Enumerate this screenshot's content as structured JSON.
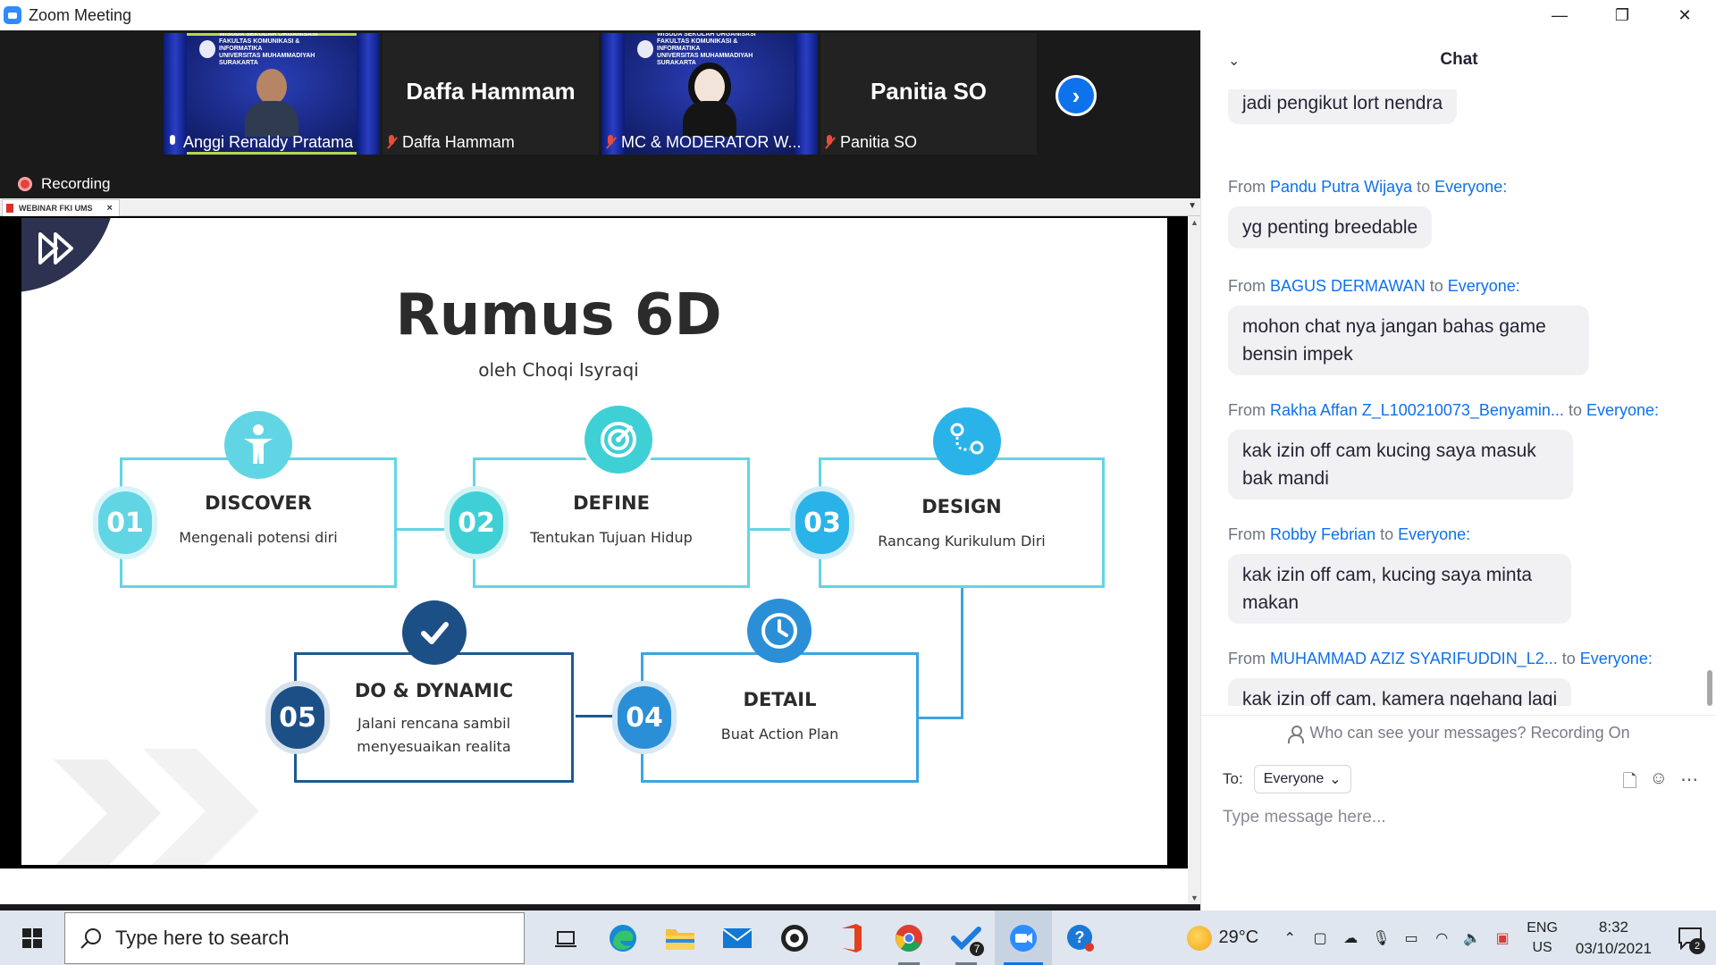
{
  "window": {
    "title": "Zoom Meeting",
    "controls": {
      "minimize": "—",
      "restore": "❐",
      "close": "✕"
    }
  },
  "participants": [
    {
      "video_banner": "WISUDA SEKOLAH ORGANISASI\nFAKULTAS KOMUNIKASI & INFORMATIKA\nUNIVERSITAS MUHAMMADIYAH SURAKARTA",
      "label": "Anggi Renaldy Pratama",
      "mic": "active",
      "active_speaker": true
    },
    {
      "display_name": "Daffa Hammam",
      "label": "Daffa Hammam",
      "mic": "muted"
    },
    {
      "video_banner": "WISUDA SEKOLAH ORGANISASI\nFAKULTAS KOMUNIKASI & INFORMATIKA\nUNIVERSITAS MUHAMMADIYAH SURAKARTA",
      "label": "MC & MODERATOR W...",
      "mic": "muted"
    },
    {
      "display_name": "Panitia SO",
      "label": "Panitia SO",
      "mic": "muted"
    }
  ],
  "recording_label": "Recording",
  "share": {
    "tab_label": "WEBINAR FKI UMS",
    "tab_close": "×"
  },
  "slide": {
    "title": "Rumus 6D",
    "subtitle": "oleh Choqi Isyraqi",
    "steps": [
      {
        "num": "01",
        "title": "DISCOVER",
        "desc": "Mengenali potensi diri",
        "icon": "person-icon"
      },
      {
        "num": "02",
        "title": "DEFINE",
        "desc": "Tentukan Tujuan Hidup",
        "icon": "target-icon"
      },
      {
        "num": "03",
        "title": "DESIGN",
        "desc": "Rancang Kurikulum Diri",
        "icon": "route-icon"
      },
      {
        "num": "04",
        "title": "DETAIL",
        "desc": "Buat Action Plan",
        "icon": "clock-icon"
      },
      {
        "num": "05",
        "title": "DO & DYNAMIC",
        "desc": "Jalani rencana sambil menyesuaikan realita",
        "icon": "check-icon"
      }
    ]
  },
  "chat": {
    "title": "Chat",
    "messages": [
      {
        "from": "",
        "to": "",
        "text": "jadi pengikut lort nendra"
      },
      {
        "from": "Pandu Putra Wijaya",
        "to": "Everyone:",
        "text": "yg penting breedable"
      },
      {
        "from": "BAGUS DERMAWAN",
        "to": "Everyone:",
        "text": "mohon chat nya jangan bahas game bensin impek"
      },
      {
        "from": "Rakha Affan Z_L100210073_Benyamin...",
        "to": "Everyone:",
        "text": "kak izin off cam kucing saya masuk bak mandi"
      },
      {
        "from": "Robby Febrian",
        "to": "Everyone:",
        "text": "kak izin off cam, kucing saya minta makan"
      },
      {
        "from": "MUHAMMAD AZIZ SYARIFUDDIN_L2...",
        "to": "Everyone:",
        "text": "kak izin off cam, kamera ngehang lagi"
      }
    ],
    "from_word": "From",
    "to_word": "to",
    "notice": "Who can see your messages? Recording On",
    "to_label": "To:",
    "recipient": "Everyone",
    "input_placeholder": "Type message here..."
  },
  "taskbar": {
    "search_placeholder": "Type here to search",
    "todo_badge": "7",
    "weather_temp": "29°C",
    "lang_top": "ENG",
    "lang_bottom": "US",
    "time": "8:32",
    "date": "03/10/2021",
    "notification_count": "2"
  },
  "colors": {
    "zoom_blue": "#0e72ed",
    "teal": "#62d5e4",
    "dark_blue": "#1c5a8f",
    "mid_blue": "#3aa6e0"
  }
}
